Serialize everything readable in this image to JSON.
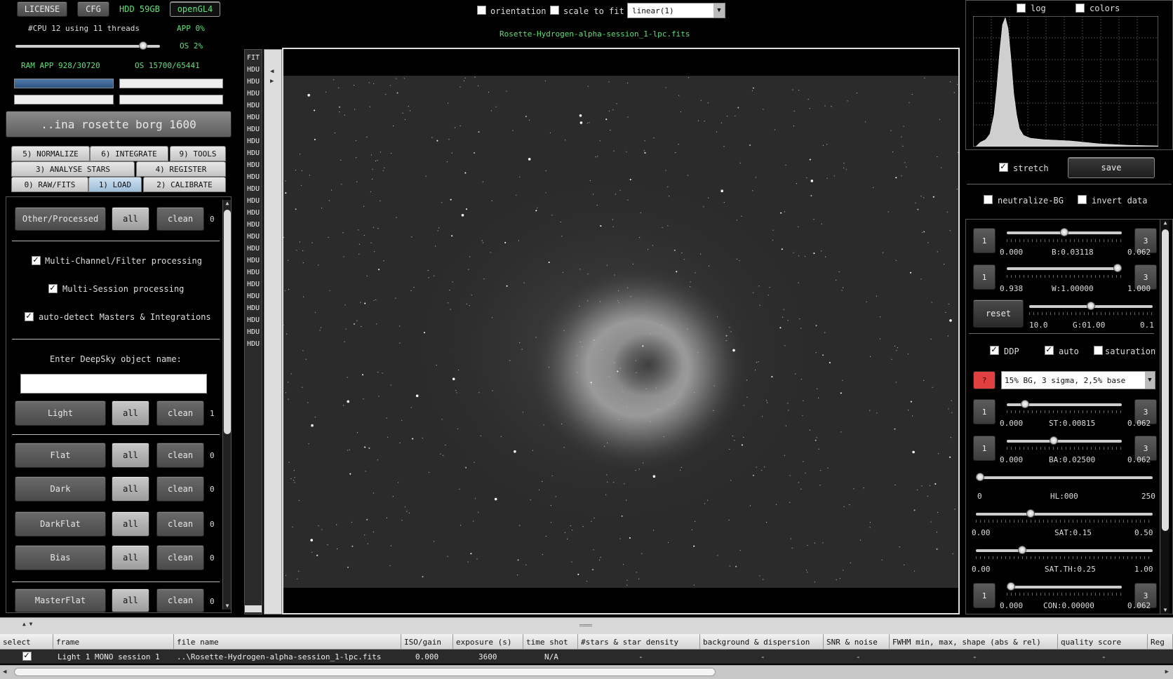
{
  "top": {
    "license": "LICENSE",
    "cfg": "CFG",
    "hdd": "HDD 59GB",
    "opengl": "openGL4",
    "cpu": "#CPU 12 using 11 threads",
    "app_cpu": "APP 0%",
    "os_cpu": "OS 2%",
    "ram": "RAM APP 928/30720",
    "os_ram": "OS 15700/65441"
  },
  "project_button": "..ina rosette borg 1600",
  "tabs": {
    "row1": [
      "5) NORMALIZE",
      "6) INTEGRATE",
      "9) TOOLS"
    ],
    "row2": [
      "3) ANALYSE STARS",
      "4) REGISTER"
    ],
    "row3": [
      "0) RAW/FITS",
      "1) LOAD",
      "2) CALIBRATE"
    ]
  },
  "load_panel": {
    "other_label": "Other/Processed",
    "all_label": "all",
    "clean_label": "clean",
    "other_count": "0",
    "multichannel": "Multi-Channel/Filter processing",
    "multisession": "Multi-Session processing",
    "autodetect": "auto-detect Masters & Integrations",
    "dso_prompt": "Enter DeepSky object name:",
    "dso_value": "",
    "frames": [
      {
        "label": "Light",
        "count": "1"
      },
      {
        "label": "Flat",
        "count": "0"
      },
      {
        "label": "Dark",
        "count": "0"
      },
      {
        "label": "DarkFlat",
        "count": "0"
      },
      {
        "label": "Bias",
        "count": "0"
      },
      {
        "label": "MasterFlat",
        "count": "0"
      }
    ]
  },
  "viewer": {
    "orientation": "orientation",
    "scale_to_fit": "scale to fit",
    "stretch_mode": "linear(1)",
    "filename": "Rosette-Hydrogen-alpha-session_1-lpc.fits",
    "hdu_list": [
      "FIT",
      "HDU",
      "HDU",
      "HDU",
      "HDU",
      "HDU",
      "HDU",
      "HDU",
      "HDU",
      "HDU",
      "HDU",
      "HDU",
      "HDU",
      "HDU",
      "HDU",
      "HDU",
      "HDU",
      "HDU",
      "HDU",
      "HDU",
      "HDU",
      "HDU",
      "HDU",
      "HDU",
      "HDU"
    ]
  },
  "right": {
    "log": "log",
    "colors": "colors",
    "stretch": "stretch",
    "save": "save",
    "neutralize": "neutralize-BG",
    "invert": "invert data",
    "b": {
      "left": "1",
      "right": "3",
      "min": "0.000",
      "label": "B:0.03118",
      "max": "0.062",
      "level": 0.5
    },
    "w": {
      "left": "1",
      "right": "3",
      "min": "0.938",
      "label": "W:1.00000",
      "max": "1.000",
      "level": 1.0
    },
    "reset": "reset",
    "g": {
      "min": "10.0",
      "label": "G:01.00",
      "max": "0.1",
      "level": 0.5
    },
    "ddp": "DDP",
    "auto": "auto",
    "saturation": "saturation",
    "qmark": "?",
    "preset": "15% BG, 3 sigma, 2,5% base",
    "st": {
      "left": "1",
      "right": "3",
      "min": "0.000",
      "label": "ST:0.00815",
      "max": "0.062",
      "level": 0.13
    },
    "ba": {
      "left": "1",
      "right": "3",
      "min": "0.000",
      "label": "BA:0.02500",
      "max": "0.062",
      "level": 0.4
    },
    "hl": {
      "min": "0",
      "label": "HL:000",
      "max": "250",
      "level": 0.0
    },
    "sat": {
      "min": "0.00",
      "label": "SAT:0.15",
      "max": "0.50",
      "level": 0.3
    },
    "satth": {
      "min": "0.00",
      "label": "SAT.TH:0.25",
      "max": "1.00",
      "level": 0.25
    },
    "con": {
      "left": "1",
      "right": "3",
      "min": "0.000",
      "label": "CON:0.00000",
      "max": "0.062",
      "level": 0.0
    }
  },
  "table": {
    "headers": [
      "select",
      "frame",
      "file name",
      "ISO/gain",
      "exposure (s)",
      "time shot",
      "#stars & star density",
      "background & dispersion",
      "SNR & noise",
      "FWHM min, max, shape (abs & rel)",
      "quality score",
      "Reg"
    ],
    "row": {
      "frame": "Light 1 MONO session 1",
      "file": "..\\Rosette-Hydrogen-alpha-session_1-lpc.fits",
      "iso": "0.000",
      "exposure": "3600",
      "time": "N/A",
      "stars": "-",
      "bg": "-",
      "snr": "-",
      "fwhm": "-",
      "quality": "-"
    }
  },
  "colors": {
    "accent_green": "#5fe07a",
    "red_button": "#e04040",
    "selected_tab": "#a9c7e2"
  }
}
